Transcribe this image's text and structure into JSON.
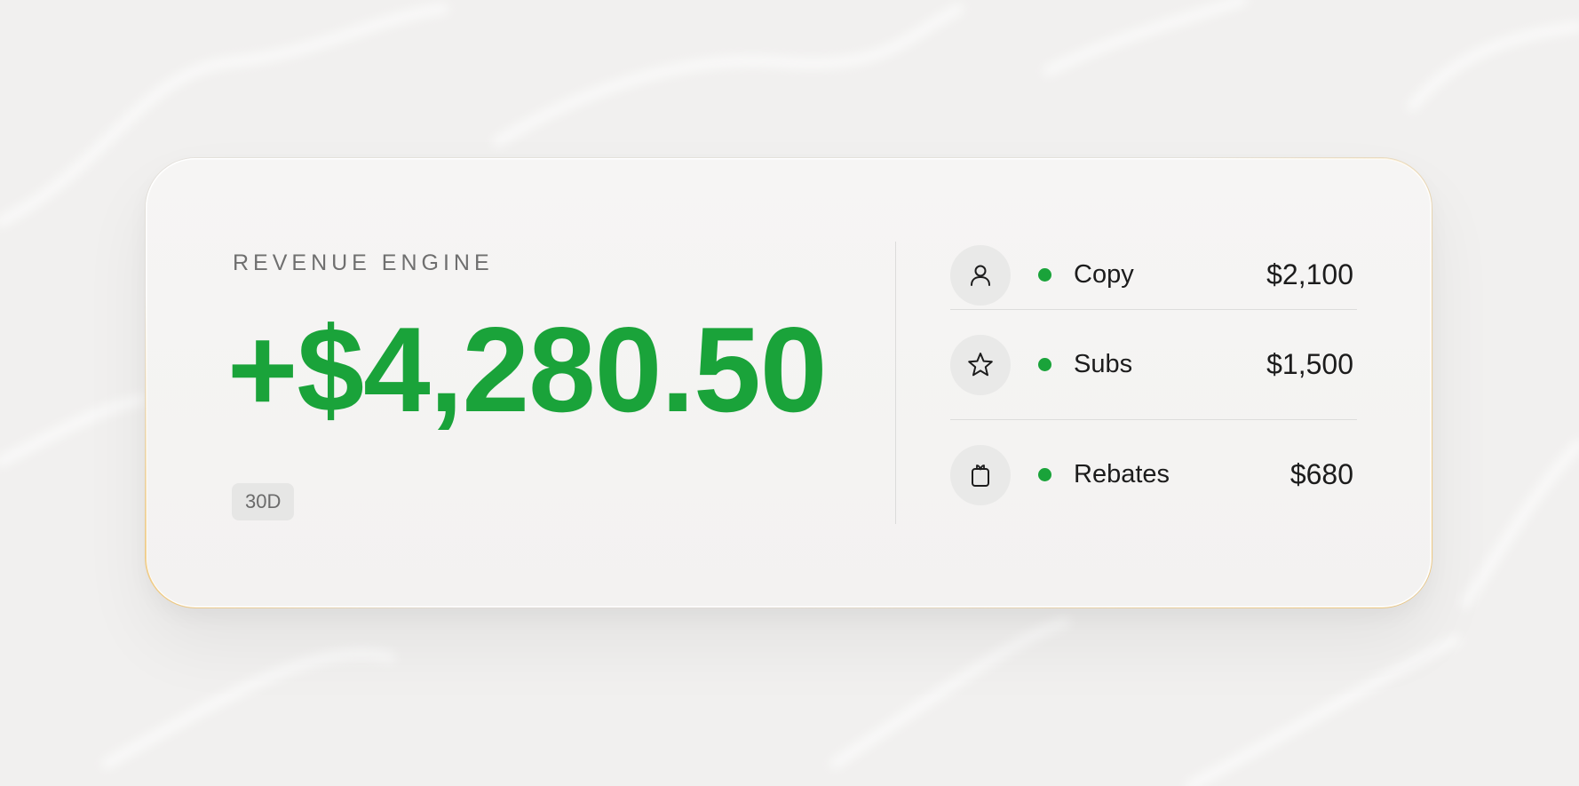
{
  "widget": {
    "eyebrow": "REVENUE ENGINE",
    "total": "+$4,280.50",
    "period": "30D",
    "accent_color": "#1aa33a"
  },
  "sources": [
    {
      "icon": "person-icon",
      "label": "Copy",
      "value": "$2,100"
    },
    {
      "icon": "star-icon",
      "label": "Subs",
      "value": "$1,500"
    },
    {
      "icon": "gift-icon",
      "label": "Rebates",
      "value": "$680"
    }
  ]
}
